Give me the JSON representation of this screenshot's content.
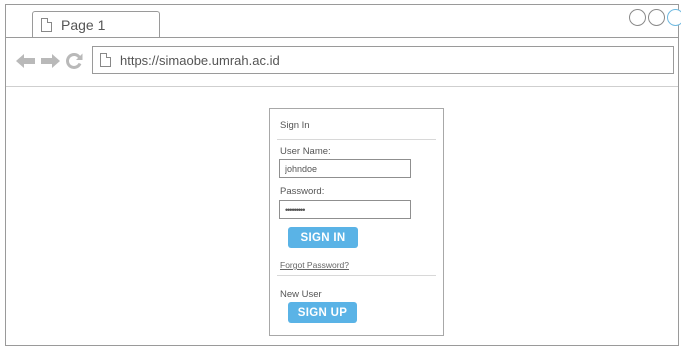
{
  "browser": {
    "tab_title": "Page 1",
    "url": "https://simaobe.umrah.ac.id"
  },
  "icons": {
    "tab": "page-icon",
    "url": "page-icon",
    "back": "back-arrow-icon",
    "forward": "forward-arrow-icon",
    "reload": "reload-icon"
  },
  "colors": {
    "button": "#5ab3e6",
    "window_control_accent": "#6fb9e0"
  },
  "signin": {
    "title": "Sign In",
    "username_label": "User Name:",
    "username_value": "johndoe",
    "password_label": "Password:",
    "password_value": "•••••••••",
    "signin_button": "SIGN IN",
    "forgot_link": "Forgot Password?",
    "new_user_label": "New User",
    "signup_button": "SIGN UP"
  }
}
